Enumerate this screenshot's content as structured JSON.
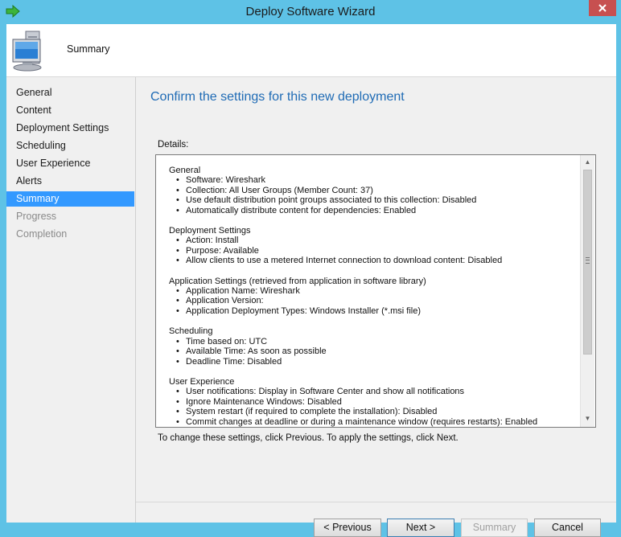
{
  "window": {
    "title": "Deploy Software Wizard",
    "close_icon": "close-icon",
    "app_icon": "green-arrow-icon"
  },
  "header": {
    "icon": "computer-monitor-icon",
    "title": "Summary"
  },
  "sidebar": {
    "items": [
      {
        "label": "General",
        "state": "completed"
      },
      {
        "label": "Content",
        "state": "completed"
      },
      {
        "label": "Deployment Settings",
        "state": "completed"
      },
      {
        "label": "Scheduling",
        "state": "completed"
      },
      {
        "label": "User Experience",
        "state": "completed"
      },
      {
        "label": "Alerts",
        "state": "completed"
      },
      {
        "label": "Summary",
        "state": "selected"
      },
      {
        "label": "Progress",
        "state": "disabled"
      },
      {
        "label": "Completion",
        "state": "disabled"
      }
    ]
  },
  "main": {
    "heading": "Confirm the settings for this new deployment",
    "details_label": "Details:",
    "details": [
      {
        "title": "General",
        "items": [
          "Software: Wireshark",
          "Collection: All User Groups (Member Count: 37)",
          "Use default distribution point groups associated to this collection: Disabled",
          "Automatically distribute content for dependencies: Enabled"
        ]
      },
      {
        "title": "Deployment Settings",
        "items": [
          "Action: Install",
          "Purpose: Available",
          "Allow clients to use a metered Internet connection to download content: Disabled"
        ]
      },
      {
        "title": "Application Settings (retrieved from application in software library)",
        "items": [
          "Application Name: Wireshark",
          "Application Version:",
          "Application Deployment Types: Windows Installer (*.msi file)"
        ]
      },
      {
        "title": "Scheduling",
        "items": [
          "Time based on: UTC",
          "Available Time: As soon as possible",
          "Deadline Time: Disabled"
        ]
      },
      {
        "title": "User Experience",
        "items": [
          "User notifications: Display in Software Center and show all notifications",
          "Ignore Maintenance Windows: Disabled",
          "System restart  (if required to complete the installation): Disabled",
          "Commit changes at deadline or during a maintenance window (requires restarts): Enabled"
        ]
      }
    ],
    "instruction": "To change these settings, click Previous. To apply the settings, click Next."
  },
  "buttons": {
    "previous": "< Previous",
    "next": "Next >",
    "summary": "Summary",
    "cancel": "Cancel"
  },
  "colors": {
    "title_bar": "#5ec2e6",
    "selected_item": "#3399ff",
    "heading": "#1f6bb5",
    "close_button": "#c75050"
  }
}
